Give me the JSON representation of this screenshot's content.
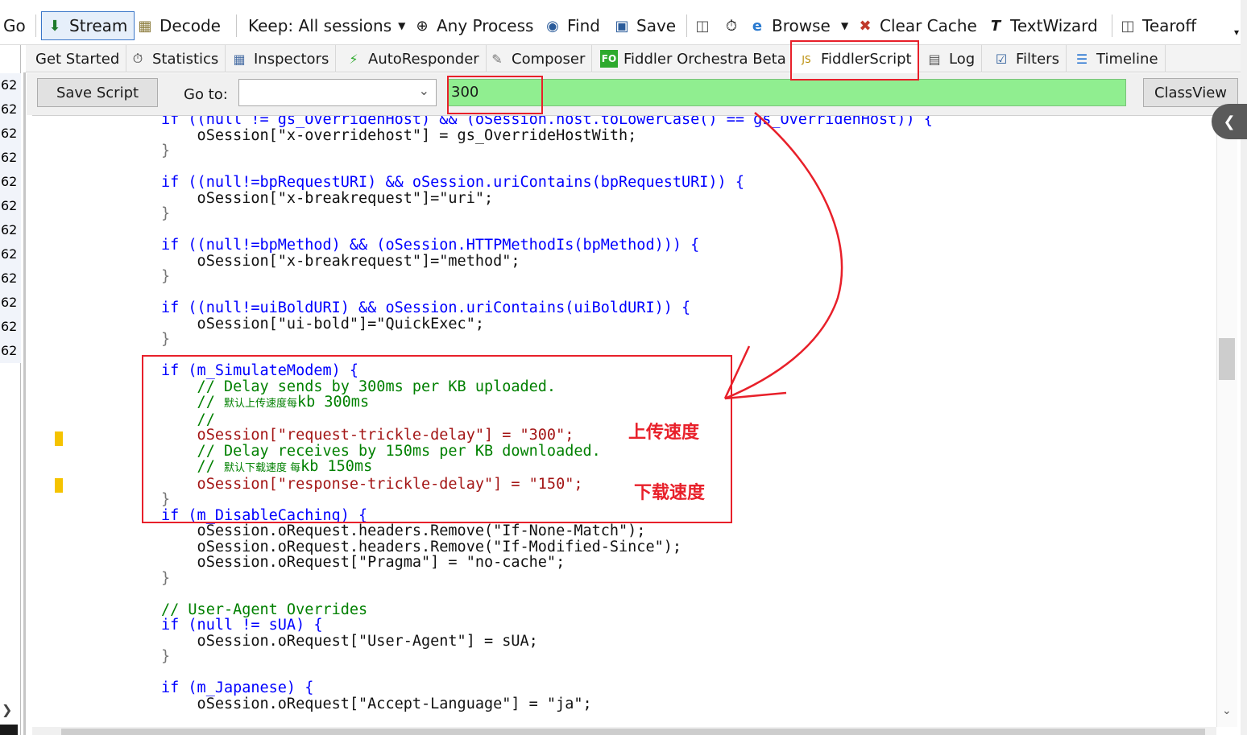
{
  "toolbar": {
    "go": "Go",
    "stream": "Stream",
    "decode": "Decode",
    "keep": "Keep: All sessions",
    "any_process": "Any Process",
    "find": "Find",
    "save": "Save",
    "browse": "Browse",
    "clear_cache": "Clear Cache",
    "text_wizard": "TextWizard",
    "tearoff": "Tearoff"
  },
  "tabs": {
    "get_started": "Get Started",
    "statistics": "Statistics",
    "inspectors": "Inspectors",
    "autoresponder": "AutoResponder",
    "composer": "Composer",
    "orchestra_icon": "FO",
    "orchestra": "Fiddler Orchestra Beta",
    "fiddlerscript": "FiddlerScript",
    "log": "Log",
    "filters": "Filters",
    "timeline": "Timeline"
  },
  "session_list": {
    "visible_numbers": [
      "62",
      "62",
      "62",
      "62",
      "62",
      "62",
      "62",
      "62",
      "62",
      "62",
      "62",
      "62"
    ]
  },
  "script_bar": {
    "save_script": "Save Script",
    "goto_label": "Go to:",
    "goto_value": "",
    "find_value": "300",
    "classview": "ClassView"
  },
  "code_lines": {
    "l1": "if ((null != gs_OverridenHost) && (oSession.host.toLowerCase() == gs_OverridenHost)) {",
    "l2": "    oSession[\"x-overridehost\"] = gs_OverrideHostWith;",
    "l3": "}",
    "l5": "if ((null!=bpRequestURI) && oSession.uriContains(bpRequestURI)) {",
    "l6": "    oSession[\"x-breakrequest\"]=\"uri\";",
    "l7": "}",
    "l9": "if ((null!=bpMethod) && (oSession.HTTPMethodIs(bpMethod))) {",
    "l10": "    oSession[\"x-breakrequest\"]=\"method\";",
    "l11": "}",
    "l13": "if ((null!=uiBoldURI) && oSession.uriContains(uiBoldURI)) {",
    "l14": "    oSession[\"ui-bold\"]=\"QuickExec\";",
    "l15": "}",
    "l17": "if (m_SimulateModem) {",
    "l18": "    // Delay sends by 300ms per KB uploaded.",
    "l19a": "    // ",
    "l19b": "默认上传速度每",
    "l19c": "kb 300ms",
    "l20": "    //",
    "l21": "    oSession[\"request-trickle-delay\"] = \"300\";",
    "l22": "    // Delay receives by 150ms per KB downloaded.",
    "l23a": "    // ",
    "l23b": "默认下载速度 每",
    "l23c": "kb 150ms",
    "l24": "    oSession[\"response-trickle-delay\"] = \"150\";",
    "l25": "}",
    "l26": "if (m_DisableCaching) {",
    "l27": "    oSession.oRequest.headers.Remove(\"If-None-Match\");",
    "l28": "    oSession.oRequest.headers.Remove(\"If-Modified-Since\");",
    "l29": "    oSession.oRequest[\"Pragma\"] = \"no-cache\";",
    "l30": "}",
    "l32": "// User-Agent Overrides",
    "l33": "if (null != sUA) {",
    "l34": "    oSession.oRequest[\"User-Agent\"] = sUA;",
    "l35": "}",
    "l37": "if (m_Japanese) {",
    "l38": "    oSession.oRequest[\"Accept-Language\"] = \"ja\";"
  },
  "annotations": {
    "upload_speed": "上传速度",
    "download_speed": "下载速度",
    "color": "#e8202a"
  },
  "colors": {
    "keyword": "#0000ff",
    "string": "#a31515",
    "comment": "#008000",
    "find_highlight": "#90ee90"
  }
}
